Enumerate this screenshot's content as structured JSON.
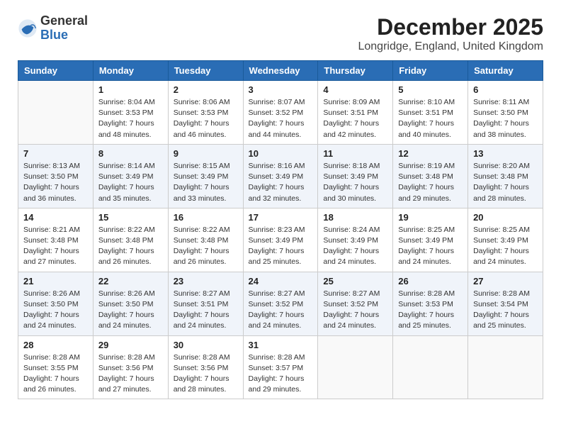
{
  "header": {
    "logo_general": "General",
    "logo_blue": "Blue",
    "month_title": "December 2025",
    "location": "Longridge, England, United Kingdom"
  },
  "days_of_week": [
    "Sunday",
    "Monday",
    "Tuesday",
    "Wednesday",
    "Thursday",
    "Friday",
    "Saturday"
  ],
  "weeks": [
    [
      {
        "day": "",
        "sunrise": "",
        "sunset": "",
        "daylight": ""
      },
      {
        "day": "1",
        "sunrise": "Sunrise: 8:04 AM",
        "sunset": "Sunset: 3:53 PM",
        "daylight": "Daylight: 7 hours and 48 minutes."
      },
      {
        "day": "2",
        "sunrise": "Sunrise: 8:06 AM",
        "sunset": "Sunset: 3:53 PM",
        "daylight": "Daylight: 7 hours and 46 minutes."
      },
      {
        "day": "3",
        "sunrise": "Sunrise: 8:07 AM",
        "sunset": "Sunset: 3:52 PM",
        "daylight": "Daylight: 7 hours and 44 minutes."
      },
      {
        "day": "4",
        "sunrise": "Sunrise: 8:09 AM",
        "sunset": "Sunset: 3:51 PM",
        "daylight": "Daylight: 7 hours and 42 minutes."
      },
      {
        "day": "5",
        "sunrise": "Sunrise: 8:10 AM",
        "sunset": "Sunset: 3:51 PM",
        "daylight": "Daylight: 7 hours and 40 minutes."
      },
      {
        "day": "6",
        "sunrise": "Sunrise: 8:11 AM",
        "sunset": "Sunset: 3:50 PM",
        "daylight": "Daylight: 7 hours and 38 minutes."
      }
    ],
    [
      {
        "day": "7",
        "sunrise": "Sunrise: 8:13 AM",
        "sunset": "Sunset: 3:50 PM",
        "daylight": "Daylight: 7 hours and 36 minutes."
      },
      {
        "day": "8",
        "sunrise": "Sunrise: 8:14 AM",
        "sunset": "Sunset: 3:49 PM",
        "daylight": "Daylight: 7 hours and 35 minutes."
      },
      {
        "day": "9",
        "sunrise": "Sunrise: 8:15 AM",
        "sunset": "Sunset: 3:49 PM",
        "daylight": "Daylight: 7 hours and 33 minutes."
      },
      {
        "day": "10",
        "sunrise": "Sunrise: 8:16 AM",
        "sunset": "Sunset: 3:49 PM",
        "daylight": "Daylight: 7 hours and 32 minutes."
      },
      {
        "day": "11",
        "sunrise": "Sunrise: 8:18 AM",
        "sunset": "Sunset: 3:49 PM",
        "daylight": "Daylight: 7 hours and 30 minutes."
      },
      {
        "day": "12",
        "sunrise": "Sunrise: 8:19 AM",
        "sunset": "Sunset: 3:48 PM",
        "daylight": "Daylight: 7 hours and 29 minutes."
      },
      {
        "day": "13",
        "sunrise": "Sunrise: 8:20 AM",
        "sunset": "Sunset: 3:48 PM",
        "daylight": "Daylight: 7 hours and 28 minutes."
      }
    ],
    [
      {
        "day": "14",
        "sunrise": "Sunrise: 8:21 AM",
        "sunset": "Sunset: 3:48 PM",
        "daylight": "Daylight: 7 hours and 27 minutes."
      },
      {
        "day": "15",
        "sunrise": "Sunrise: 8:22 AM",
        "sunset": "Sunset: 3:48 PM",
        "daylight": "Daylight: 7 hours and 26 minutes."
      },
      {
        "day": "16",
        "sunrise": "Sunrise: 8:22 AM",
        "sunset": "Sunset: 3:48 PM",
        "daylight": "Daylight: 7 hours and 26 minutes."
      },
      {
        "day": "17",
        "sunrise": "Sunrise: 8:23 AM",
        "sunset": "Sunset: 3:49 PM",
        "daylight": "Daylight: 7 hours and 25 minutes."
      },
      {
        "day": "18",
        "sunrise": "Sunrise: 8:24 AM",
        "sunset": "Sunset: 3:49 PM",
        "daylight": "Daylight: 7 hours and 24 minutes."
      },
      {
        "day": "19",
        "sunrise": "Sunrise: 8:25 AM",
        "sunset": "Sunset: 3:49 PM",
        "daylight": "Daylight: 7 hours and 24 minutes."
      },
      {
        "day": "20",
        "sunrise": "Sunrise: 8:25 AM",
        "sunset": "Sunset: 3:49 PM",
        "daylight": "Daylight: 7 hours and 24 minutes."
      }
    ],
    [
      {
        "day": "21",
        "sunrise": "Sunrise: 8:26 AM",
        "sunset": "Sunset: 3:50 PM",
        "daylight": "Daylight: 7 hours and 24 minutes."
      },
      {
        "day": "22",
        "sunrise": "Sunrise: 8:26 AM",
        "sunset": "Sunset: 3:50 PM",
        "daylight": "Daylight: 7 hours and 24 minutes."
      },
      {
        "day": "23",
        "sunrise": "Sunrise: 8:27 AM",
        "sunset": "Sunset: 3:51 PM",
        "daylight": "Daylight: 7 hours and 24 minutes."
      },
      {
        "day": "24",
        "sunrise": "Sunrise: 8:27 AM",
        "sunset": "Sunset: 3:52 PM",
        "daylight": "Daylight: 7 hours and 24 minutes."
      },
      {
        "day": "25",
        "sunrise": "Sunrise: 8:27 AM",
        "sunset": "Sunset: 3:52 PM",
        "daylight": "Daylight: 7 hours and 24 minutes."
      },
      {
        "day": "26",
        "sunrise": "Sunrise: 8:28 AM",
        "sunset": "Sunset: 3:53 PM",
        "daylight": "Daylight: 7 hours and 25 minutes."
      },
      {
        "day": "27",
        "sunrise": "Sunrise: 8:28 AM",
        "sunset": "Sunset: 3:54 PM",
        "daylight": "Daylight: 7 hours and 25 minutes."
      }
    ],
    [
      {
        "day": "28",
        "sunrise": "Sunrise: 8:28 AM",
        "sunset": "Sunset: 3:55 PM",
        "daylight": "Daylight: 7 hours and 26 minutes."
      },
      {
        "day": "29",
        "sunrise": "Sunrise: 8:28 AM",
        "sunset": "Sunset: 3:56 PM",
        "daylight": "Daylight: 7 hours and 27 minutes."
      },
      {
        "day": "30",
        "sunrise": "Sunrise: 8:28 AM",
        "sunset": "Sunset: 3:56 PM",
        "daylight": "Daylight: 7 hours and 28 minutes."
      },
      {
        "day": "31",
        "sunrise": "Sunrise: 8:28 AM",
        "sunset": "Sunset: 3:57 PM",
        "daylight": "Daylight: 7 hours and 29 minutes."
      },
      {
        "day": "",
        "sunrise": "",
        "sunset": "",
        "daylight": ""
      },
      {
        "day": "",
        "sunrise": "",
        "sunset": "",
        "daylight": ""
      },
      {
        "day": "",
        "sunrise": "",
        "sunset": "",
        "daylight": ""
      }
    ]
  ]
}
